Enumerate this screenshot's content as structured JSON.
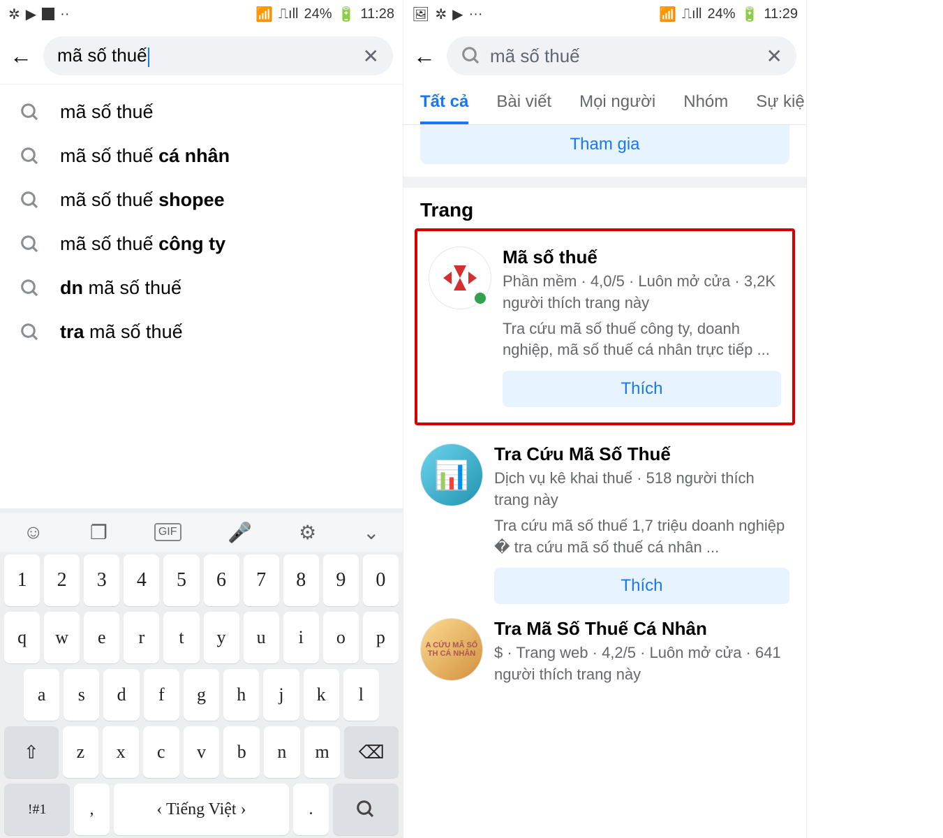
{
  "left": {
    "status": {
      "battery": "24%",
      "time": "11:28",
      "icons_left": [
        "pinwheel-icon",
        "youtube-icon",
        "flipboard-icon",
        "more-icon"
      ],
      "icons_right": [
        "wifi-icon",
        "signal-icon"
      ]
    },
    "search_value": "mã số thuế",
    "suggestions": [
      {
        "prefix": "",
        "base": "mã số thuế",
        "bold": ""
      },
      {
        "prefix": "",
        "base": "mã số thuế ",
        "bold": "cá nhân"
      },
      {
        "prefix": "",
        "base": "mã số thuế ",
        "bold": "shopee"
      },
      {
        "prefix": "",
        "base": "mã số thuế ",
        "bold": "công ty"
      },
      {
        "prefix_bold": "dn ",
        "base": "mã số thuế",
        "bold": ""
      },
      {
        "prefix_bold": "tra ",
        "base": "mã số thuế",
        "bold": ""
      }
    ],
    "keyboard": {
      "row_num": [
        "1",
        "2",
        "3",
        "4",
        "5",
        "6",
        "7",
        "8",
        "9",
        "0"
      ],
      "row1": [
        "q",
        "w",
        "e",
        "r",
        "t",
        "y",
        "u",
        "i",
        "o",
        "p"
      ],
      "row2": [
        "a",
        "s",
        "d",
        "f",
        "g",
        "h",
        "j",
        "k",
        "l"
      ],
      "row3": [
        "z",
        "x",
        "c",
        "v",
        "b",
        "n",
        "m"
      ],
      "shift": "⇧",
      "backspace": "⌫",
      "symbols": "!#1",
      "comma": ",",
      "space_label": "‹ Tiếng Việt ›",
      "period": ".",
      "enter": "🔍"
    }
  },
  "right": {
    "status": {
      "battery": "24%",
      "time": "11:29",
      "icons_left": [
        "image-icon",
        "pinwheel-icon",
        "youtube-icon",
        "more-icon"
      ],
      "icons_right": [
        "wifi-icon",
        "signal-icon"
      ]
    },
    "search_value": "mã số thuế",
    "tabs": [
      "Tất cả",
      "Bài viết",
      "Mọi người",
      "Nhóm",
      "Sự kiệ"
    ],
    "active_tab": 0,
    "join_label": "Tham gia",
    "section_title": "Trang",
    "pages": [
      {
        "title": "Mã số thuế",
        "meta": "Phần mềm · 4,0/5 · Luôn mở cửa · 3,2K người thích trang này",
        "desc": "Tra cứu mã số thuế công ty, doanh nghiệp, mã số thuế cá nhân trực tiếp ...",
        "like": "Thích",
        "online": true
      },
      {
        "title": "Tra Cứu Mã Số Thuế",
        "meta": "Dịch vụ kê khai thuế · 518 người thích trang này",
        "desc": "Tra cứu mã số thuế 1,7 triệu doanh nghiệp � tra cứu mã số thuế cá nhân ...",
        "like": "Thích",
        "online": false
      },
      {
        "title": "Tra Mã Số Thuế Cá Nhân",
        "meta": "$ · Trang web · 4,2/5 · Luôn mở cửa · 641 người thích trang này",
        "desc": "",
        "like": "",
        "online": false,
        "avatar_text": "A CỨU MÃ SỐ TH CÁ NHÂN"
      }
    ]
  }
}
